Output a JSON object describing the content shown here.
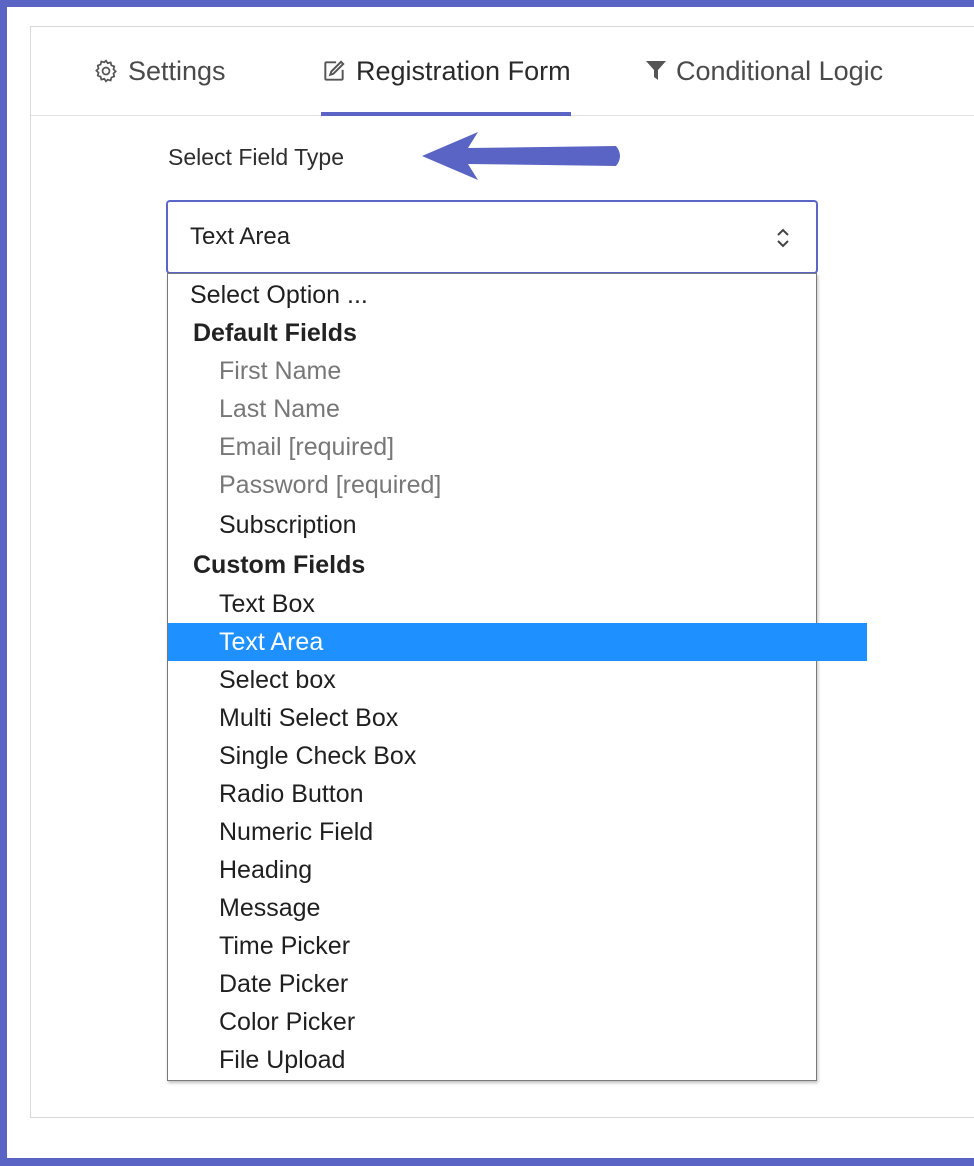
{
  "tabs": {
    "settings": "Settings",
    "registration_form": "Registration Form",
    "conditional_logic": "Conditional Logic",
    "active": "Registration Form"
  },
  "form": {
    "field_type_label": "Select Field Type",
    "selected_value": "Text Area"
  },
  "dropdown": {
    "placeholder": "Select Option ...",
    "groups": [
      {
        "label": "Default Fields",
        "options": [
          {
            "label": "First Name",
            "disabled": true
          },
          {
            "label": "Last Name",
            "disabled": true
          },
          {
            "label": "Email [required]",
            "disabled": true
          },
          {
            "label": "Password [required]",
            "disabled": true
          },
          {
            "label": "Subscription",
            "disabled": false
          }
        ]
      },
      {
        "label": "Custom Fields",
        "options": [
          {
            "label": "Text Box"
          },
          {
            "label": "Text Area",
            "selected": true
          },
          {
            "label": "Select box"
          },
          {
            "label": "Multi Select Box"
          },
          {
            "label": "Single Check Box"
          },
          {
            "label": "Radio Button"
          },
          {
            "label": "Numeric Field"
          },
          {
            "label": "Heading"
          },
          {
            "label": "Message"
          },
          {
            "label": "Time Picker"
          },
          {
            "label": "Date Picker"
          },
          {
            "label": "Color Picker"
          },
          {
            "label": "File Upload"
          }
        ]
      }
    ]
  },
  "colors": {
    "accent": "#5a64c4",
    "highlight": "#1e90ff",
    "annotation_arrow": "#5a64c4"
  },
  "icons": {
    "settings": "gear-icon",
    "registration_form": "edit-icon",
    "conditional_logic": "filter-icon",
    "select_toggle": "up-down-chevron-icon",
    "annotation": "arrow-left-icon"
  }
}
